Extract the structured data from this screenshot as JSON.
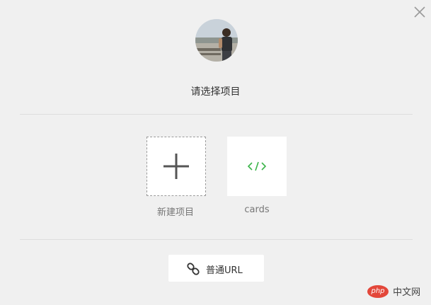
{
  "dialog": {
    "title": "请选择项目"
  },
  "tiles": [
    {
      "label": "新建项目",
      "icon": "plus-icon"
    },
    {
      "label": "cards",
      "icon": "code-icon"
    }
  ],
  "url_button": {
    "label": "普通URL",
    "icon": "link-icon"
  },
  "watermark": {
    "logo": "php",
    "site": "中文网"
  },
  "colors": {
    "background": "#f0f0f0",
    "accent_green": "#3bb44a",
    "text": "#333333"
  }
}
